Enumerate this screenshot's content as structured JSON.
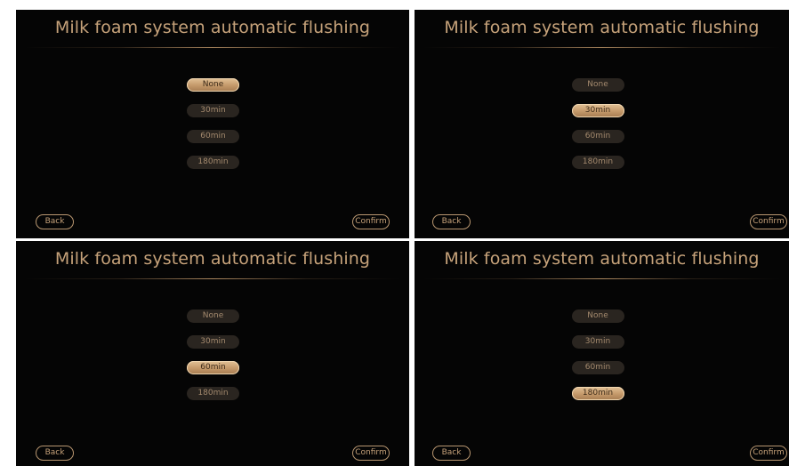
{
  "screens": [
    {
      "title": "Milk foam system automatic flushing",
      "options": [
        "None",
        "30min",
        "60min",
        "180min"
      ],
      "selected": "None",
      "back_label": "Back",
      "confirm_label": "Confirm"
    },
    {
      "title": "Milk foam system automatic flushing",
      "options": [
        "None",
        "30min",
        "60min",
        "180min"
      ],
      "selected": "30min",
      "back_label": "Back",
      "confirm_label": "Confirm"
    },
    {
      "title": "Milk foam system automatic flushing",
      "options": [
        "None",
        "30min",
        "60min",
        "180min"
      ],
      "selected": "60min",
      "back_label": "Back",
      "confirm_label": "Confirm"
    },
    {
      "title": "Milk foam system automatic flushing",
      "options": [
        "None",
        "30min",
        "60min",
        "180min"
      ],
      "selected": "180min",
      "back_label": "Back",
      "confirm_label": "Confirm"
    }
  ],
  "colors": {
    "background": "#050505",
    "accent": "#c6a27a",
    "option_idle": "#2a2520",
    "option_selected": "#d2ad80"
  }
}
